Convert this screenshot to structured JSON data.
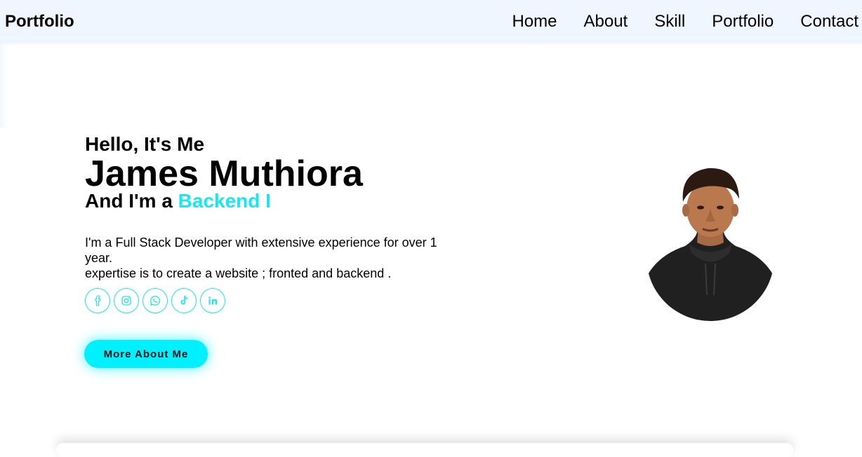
{
  "header": {
    "logo": "Portfolio",
    "nav": [
      "Home",
      "About",
      "Skill",
      "Portfolio",
      "Contact"
    ]
  },
  "hero": {
    "greeting": "Hello, It's Me",
    "name": "James Muthiora",
    "role_prefix": "And I'm a ",
    "role_highlight": "Backend I",
    "description_line1": "I'm a Full Stack Developer with extensive experience for over 1 year.",
    "description_line2": "expertise is to create a website ; fronted and backend .",
    "cta_label": "More About Me",
    "accent_color": "#17e8f0",
    "cta_color": "#00f0ff"
  },
  "socials": [
    {
      "icon": "facebook-icon"
    },
    {
      "icon": "instagram-icon"
    },
    {
      "icon": "whatsapp-icon"
    },
    {
      "icon": "tiktok-icon"
    },
    {
      "icon": "linkedin-icon"
    }
  ],
  "header_bg": "#eff6ff"
}
